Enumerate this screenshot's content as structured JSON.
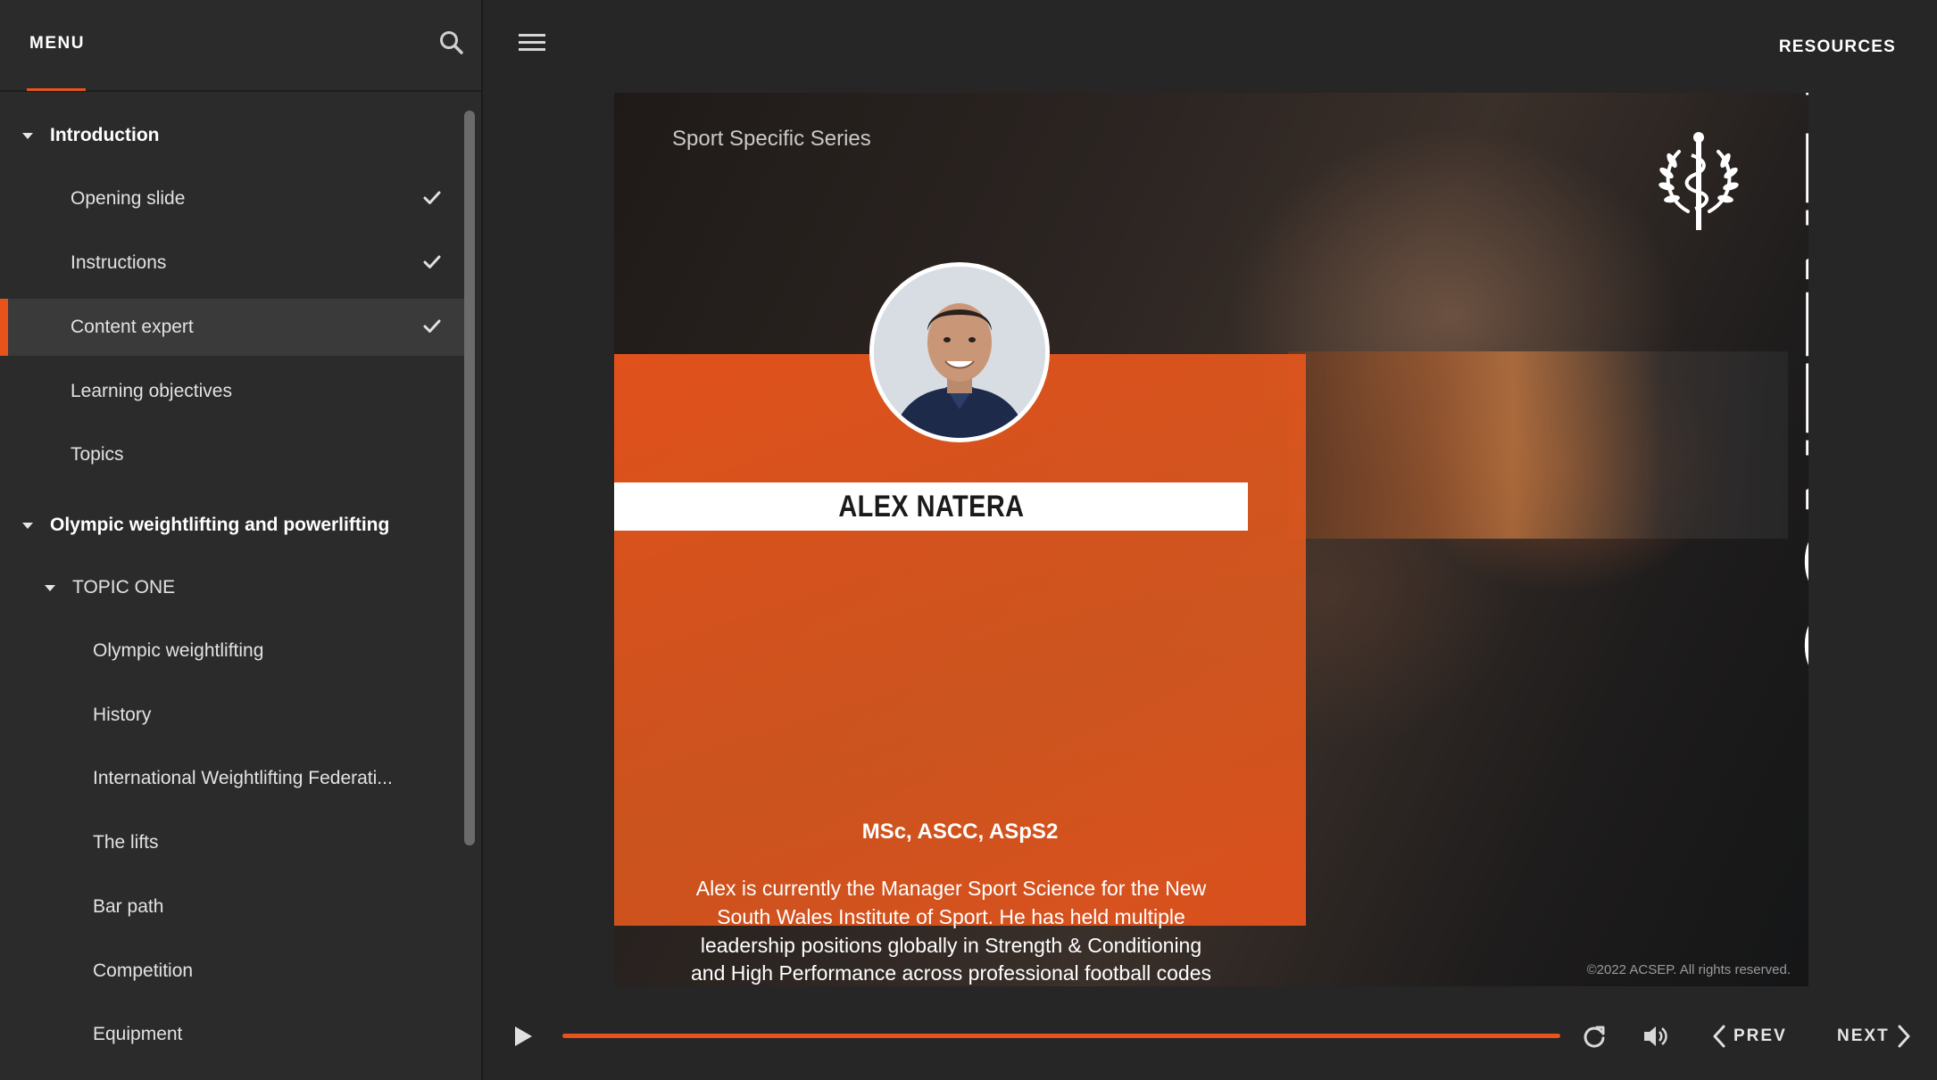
{
  "menu": {
    "title": "MENU",
    "items": [
      {
        "label": "Introduction",
        "level": 0,
        "section": true
      },
      {
        "label": "Opening slide",
        "level": 1,
        "checked": true
      },
      {
        "label": "Instructions",
        "level": 1,
        "checked": true
      },
      {
        "label": "Content expert",
        "level": 1,
        "checked": true,
        "active": true
      },
      {
        "label": "Learning objectives",
        "level": 1
      },
      {
        "label": "Topics",
        "level": 1
      },
      {
        "label": "Olympic weightlifting and powerlifting",
        "level": 0,
        "section": true
      },
      {
        "label": "TOPIC ONE",
        "level": 1,
        "expandable": true
      },
      {
        "label": "Olympic weightlifting",
        "level": 2
      },
      {
        "label": "History",
        "level": 2
      },
      {
        "label": "International Weightlifting Federati...",
        "level": 2
      },
      {
        "label": "The lifts",
        "level": 2
      },
      {
        "label": "Bar path",
        "level": 2
      },
      {
        "label": "Competition",
        "level": 2
      },
      {
        "label": "Equipment",
        "level": 2
      }
    ]
  },
  "topbar": {
    "resources_label": "RESOURCES"
  },
  "slide": {
    "series_label": "Sport Specific Series",
    "vertical_title": "CONTENT EXPERT",
    "expert_name": "ALEX NATERA",
    "credentials": "MSc, ASCC, ASpS2",
    "bio": "Alex is currently the Manager Sport Science for the New South Wales Institute of Sport. He has held multiple leadership positions globally in Strength & Conditioning and High Performance across professional football codes and Olympic sports over the past 20 years. Currently completing his PhD in repeat power ability, Alex is a consultant to a number of high profile sporting franchises and is considered an international leader in the field of Strength & Conditioning.",
    "copyright": "©2022 ACSEP. All rights reserved."
  },
  "controls": {
    "prev_label": "PREV",
    "next_label": "NEXT",
    "progress": 1.0
  },
  "colors": {
    "accent": "#e8531c",
    "sidebar_bg": "#2b2b2b",
    "app_bg": "#262626"
  }
}
